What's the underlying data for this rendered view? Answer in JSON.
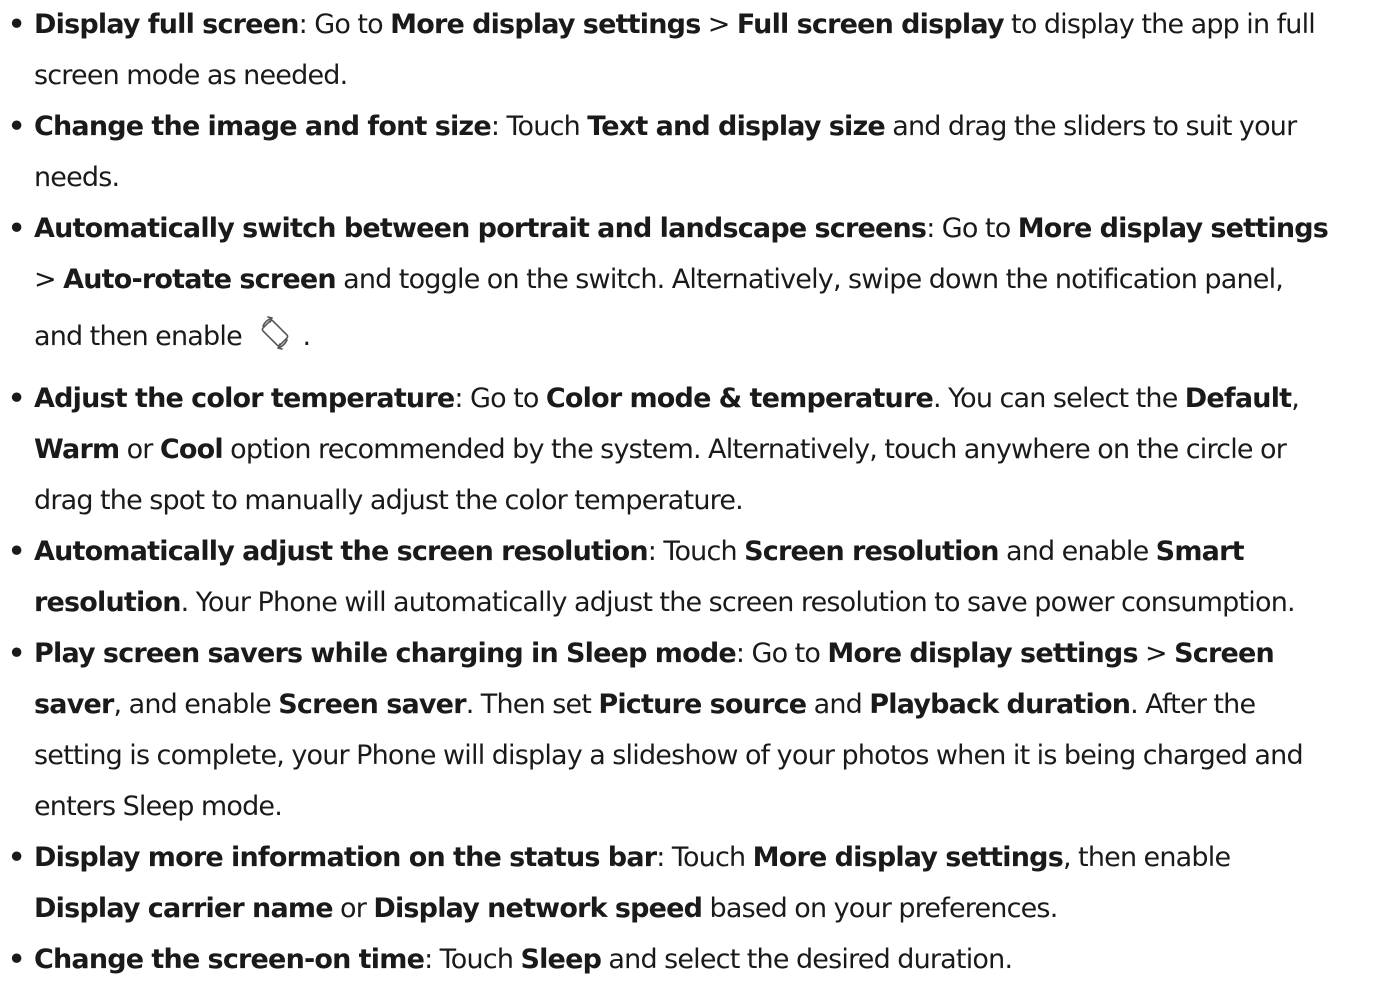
{
  "bullet_char": "•",
  "items": [
    {
      "lines": [
        [
          {
            "t": "Display full screen",
            "b": true
          },
          {
            "t": ": Go to ",
            "b": false
          },
          {
            "t": "More display settings",
            "b": true
          },
          {
            "t": " > ",
            "b": false
          },
          {
            "t": "Full screen display",
            "b": true
          },
          {
            "t": " to display the app in full",
            "b": false
          }
        ],
        [
          {
            "t": "screen mode as needed.",
            "b": false
          }
        ]
      ]
    },
    {
      "lines": [
        [
          {
            "t": "Change the image and font size",
            "b": true
          },
          {
            "t": ": Touch ",
            "b": false
          },
          {
            "t": "Text and display size",
            "b": true
          },
          {
            "t": " and drag the sliders to suit your",
            "b": false
          }
        ],
        [
          {
            "t": "needs.",
            "b": false
          }
        ]
      ]
    },
    {
      "lines": [
        [
          {
            "t": "Automatically switch between portrait and landscape screens",
            "b": true
          },
          {
            "t": ": Go to ",
            "b": false
          },
          {
            "t": "More display settings",
            "b": true
          }
        ],
        [
          {
            "t": "> ",
            "b": false
          },
          {
            "t": "Auto-rotate screen",
            "b": true
          },
          {
            "t": " and toggle on the switch. Alternatively, swipe down the notification panel,",
            "b": false
          }
        ],
        [
          {
            "t": "and then enable ",
            "b": false
          },
          {
            "icon": "auto-rotate-icon"
          },
          {
            "t": " .",
            "b": false
          }
        ]
      ]
    },
    {
      "lines": [
        [
          {
            "t": "Adjust the color temperature",
            "b": true
          },
          {
            "t": ": Go to ",
            "b": false
          },
          {
            "t": "Color mode & temperature",
            "b": true
          },
          {
            "t": ". You can select the ",
            "b": false
          },
          {
            "t": "Default",
            "b": true
          },
          {
            "t": ",",
            "b": false
          }
        ],
        [
          {
            "t": "Warm",
            "b": true
          },
          {
            "t": " or ",
            "b": false
          },
          {
            "t": "Cool",
            "b": true
          },
          {
            "t": " option recommended by the system. Alternatively, touch anywhere on the circle or",
            "b": false
          }
        ],
        [
          {
            "t": "drag the spot to manually adjust the color temperature.",
            "b": false
          }
        ]
      ]
    },
    {
      "lines": [
        [
          {
            "t": "Automatically adjust the screen resolution",
            "b": true
          },
          {
            "t": ": Touch ",
            "b": false
          },
          {
            "t": "Screen resolution",
            "b": true
          },
          {
            "t": " and enable ",
            "b": false
          },
          {
            "t": "Smart",
            "b": true
          }
        ],
        [
          {
            "t": "resolution",
            "b": true
          },
          {
            "t": ". Your Phone will automatically adjust the screen resolution to save power consumption.",
            "b": false
          }
        ]
      ]
    },
    {
      "lines": [
        [
          {
            "t": "Play screen savers while charging in Sleep mode",
            "b": true
          },
          {
            "t": ": Go to ",
            "b": false
          },
          {
            "t": "More display settings",
            "b": true
          },
          {
            "t": " > ",
            "b": false
          },
          {
            "t": "Screen",
            "b": true
          }
        ],
        [
          {
            "t": "saver",
            "b": true
          },
          {
            "t": ", and enable ",
            "b": false
          },
          {
            "t": "Screen saver",
            "b": true
          },
          {
            "t": ". Then set ",
            "b": false
          },
          {
            "t": "Picture source",
            "b": true
          },
          {
            "t": " and ",
            "b": false
          },
          {
            "t": "Playback duration",
            "b": true
          },
          {
            "t": ". After the",
            "b": false
          }
        ],
        [
          {
            "t": "setting is complete, your Phone will display a slideshow of your photos when it is being charged and",
            "b": false
          }
        ],
        [
          {
            "t": "enters Sleep mode.",
            "b": false
          }
        ]
      ]
    },
    {
      "lines": [
        [
          {
            "t": "Display more information on the status bar",
            "b": true
          },
          {
            "t": ": Touch ",
            "b": false
          },
          {
            "t": "More display settings",
            "b": true
          },
          {
            "t": ", then enable",
            "b": false
          }
        ],
        [
          {
            "t": "Display carrier name",
            "b": true
          },
          {
            "t": " or ",
            "b": false
          },
          {
            "t": "Display network speed",
            "b": true
          },
          {
            "t": " based on your preferences.",
            "b": false
          }
        ]
      ]
    },
    {
      "lines": [
        [
          {
            "t": "Change the screen-on time",
            "b": true
          },
          {
            "t": ": Touch ",
            "b": false
          },
          {
            "t": "Sleep",
            "b": true
          },
          {
            "t": " and select the desired duration.",
            "b": false
          }
        ]
      ]
    }
  ]
}
